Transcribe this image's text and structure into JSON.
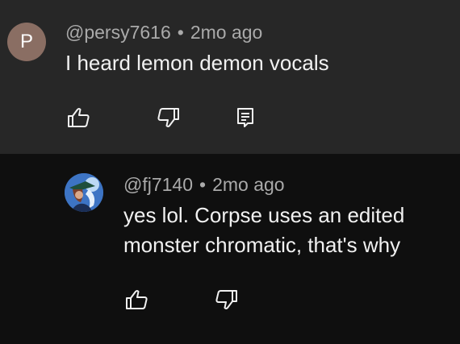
{
  "comments": [
    {
      "avatar_letter": "P",
      "avatar_color": "#8a6e63",
      "username": "@persy7616",
      "separator": "•",
      "time": "2mo ago",
      "text": "I heard lemon demon vocals",
      "actions": [
        "like-icon",
        "dislike-icon",
        "reply-icon"
      ]
    },
    {
      "avatar_color": "#2f5f9e",
      "username": "@fj7140",
      "separator": "•",
      "time": "2mo ago",
      "text": "yes lol. Corpse uses an edited monster chromatic, that's why",
      "actions": [
        "like-icon",
        "dislike-icon"
      ]
    }
  ],
  "colors": {
    "top_background": "#272727",
    "reply_background": "#0f0f0f",
    "primary_text": "#f1f1f1",
    "secondary_text": "#aaaaaa"
  }
}
